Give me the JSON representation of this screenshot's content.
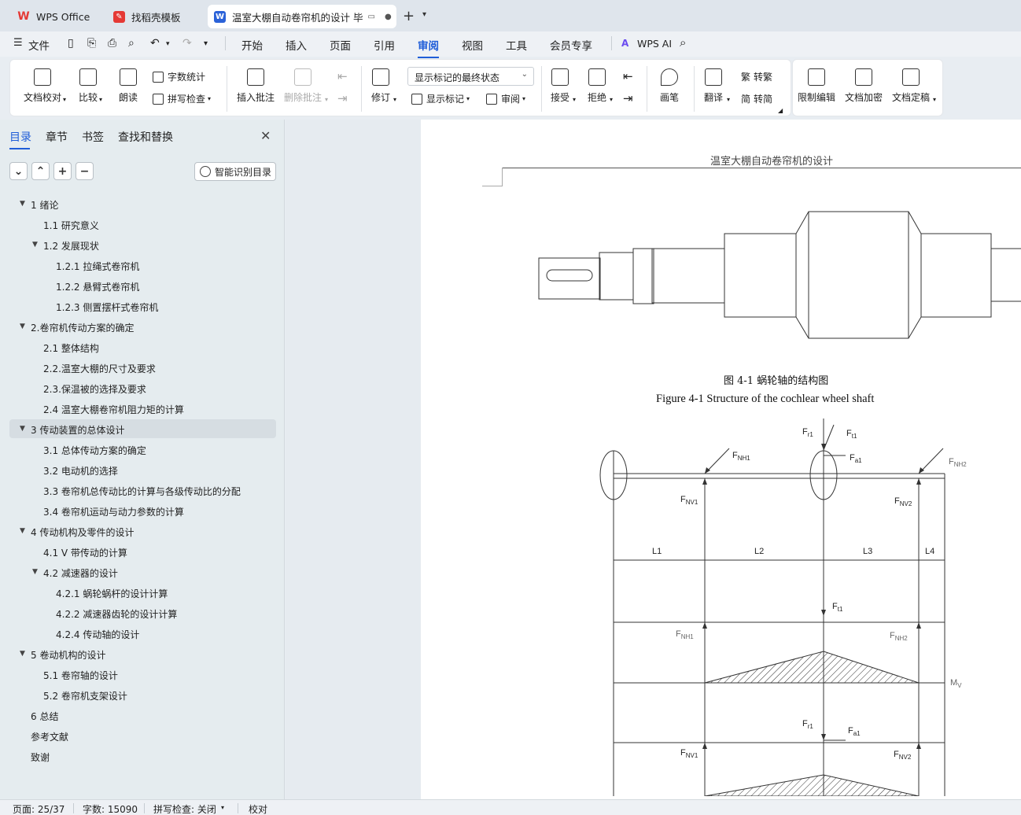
{
  "tabs": [
    {
      "label": "WPS Office"
    },
    {
      "label": "找稻壳模板"
    },
    {
      "label": "温室大棚自动卷帘机的设计 毕"
    }
  ],
  "menu": {
    "file": "文件",
    "items": [
      "开始",
      "插入",
      "页面",
      "引用",
      "审阅",
      "视图",
      "工具",
      "会员专享"
    ],
    "active": "审阅",
    "ai": "WPS AI"
  },
  "ribbon": {
    "doc_check": "文档校对",
    "compare": "比较",
    "read_aloud": "朗读",
    "word_count": "字数统计",
    "spell_check": "拼写检查",
    "insert_comment": "插入批注",
    "delete_comment": "删除批注",
    "revise": "修订",
    "markup_state": "显示标记的最终状态",
    "show_markup": "显示标记",
    "review": "审阅",
    "accept": "接受",
    "reject": "拒绝",
    "pen": "画笔",
    "translate": "翻译",
    "to_traditional": "转繁",
    "to_simplified": "转简",
    "restrict_edit": "限制编辑",
    "encrypt": "文档加密",
    "finalize": "文档定稿"
  },
  "sidebar": {
    "tabs": [
      "目录",
      "章节",
      "书签",
      "查找和替换"
    ],
    "active_tab": "目录",
    "smart_toc": "智能识别目录",
    "toc": [
      {
        "label": "1   绪论",
        "level": 1,
        "toggle": "open"
      },
      {
        "label": "1.1 研究意义",
        "level": 2
      },
      {
        "label": "1.2 发展现状",
        "level": 2,
        "toggle": "open"
      },
      {
        "label": "1.2.1  拉绳式卷帘机",
        "level": 3
      },
      {
        "label": "1.2.2  悬臂式卷帘机",
        "level": 3
      },
      {
        "label": "1.2.3  侧置摆杆式卷帘机",
        "level": 3
      },
      {
        "label": "2.卷帘机传动方案的确定",
        "level": 1,
        "toggle": "open"
      },
      {
        "label": "2.1 整体结构",
        "level": 2
      },
      {
        "label": "2.2.温室大棚的尺寸及要求",
        "level": 2
      },
      {
        "label": "2.3.保温被的选择及要求",
        "level": 2
      },
      {
        "label": "2.4 温室大棚卷帘机阻力矩的计算",
        "level": 2
      },
      {
        "label": "3 传动装置的总体设计",
        "level": 1,
        "toggle": "open",
        "selected": true
      },
      {
        "label": "3.1 总体传动方案的确定",
        "level": 2
      },
      {
        "label": "3.2 电动机的选择",
        "level": 2
      },
      {
        "label": "3.3  卷帘机总传动比的计算与各级传动比的分配",
        "level": 2
      },
      {
        "label": "3.4  卷帘机运动与动力参数的计算",
        "level": 2
      },
      {
        "label": "4 传动机构及零件的设计",
        "level": 1,
        "toggle": "open"
      },
      {
        "label": "4.1 V 带传动的计算",
        "level": 2
      },
      {
        "label": "4.2 减速器的设计",
        "level": 2,
        "toggle": "open"
      },
      {
        "label": "4.2.1  蜗轮蜗杆的设计计算",
        "level": 3
      },
      {
        "label": "4.2.2 减速器齿轮的设计计算",
        "level": 3
      },
      {
        "label": "4.2.4  传动轴的设计",
        "level": 3
      },
      {
        "label": "5 卷动机构的设计",
        "level": 1,
        "toggle": "open"
      },
      {
        "label": "5.1 卷帘轴的设计",
        "level": 2
      },
      {
        "label": "5.2 卷帘机支架设计",
        "level": 2
      },
      {
        "label": "6 总结",
        "level": 1
      },
      {
        "label": "参考文献",
        "level": 1
      },
      {
        "label": "致谢",
        "level": 1
      }
    ]
  },
  "document": {
    "header": "温室大棚自动卷帘机的设计",
    "caption_cn": "图 4-1  蜗轮轴的结构图",
    "caption_en": "Figure 4-1 Structure of the cochlear wheel shaft",
    "diagram_labels": {
      "fr1": "F",
      "fr1_sub": "r1",
      "ft1": "F",
      "ft1_sub": "t1",
      "fa1": "F",
      "fa1_sub": "a1",
      "fnh1": "F",
      "fnh1_sub": "NH1",
      "fnh2": "F",
      "fnh2_sub": "NH2",
      "fnv1": "F",
      "fnv1_sub": "NV1",
      "fnv2": "F",
      "fnv2_sub": "NV2",
      "l1": "L1",
      "l2": "L2",
      "l3": "L3",
      "l4": "L4",
      "mv": "M",
      "mv_sub": "V"
    }
  },
  "status": {
    "page": "页面: 25/37",
    "words": "字数: 15090",
    "spell": "拼写检查: 关闭",
    "proof": "校对"
  }
}
